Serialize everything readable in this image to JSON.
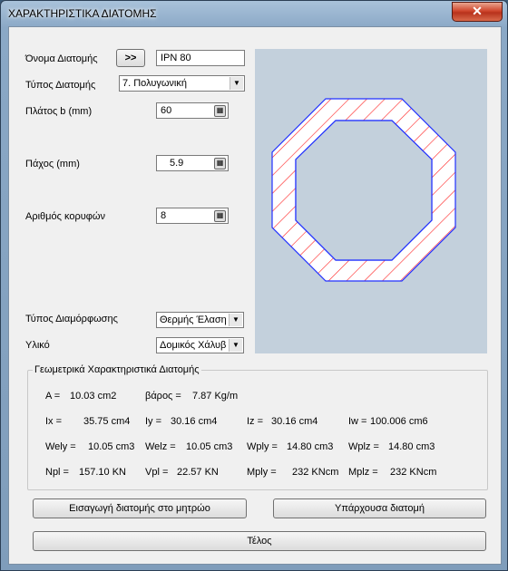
{
  "window": {
    "title": "ΧΑΡΑΚΤΗΡΙΣΤΙΚΑ ΔΙΑΤΟΜΗΣ",
    "close_symbol": "✕"
  },
  "form": {
    "name_label": "Όνομα Διατομής",
    "name_button": ">>",
    "name_value": "IPN 80",
    "type_label": "Τύπος Διατομής",
    "type_value": "7. Πολυγωνική",
    "width_label": "Πλάτος b (mm)",
    "width_value": "60",
    "thickness_label": "Πάχος (mm)",
    "thickness_value": "5.9",
    "vertices_label": "Αριθμός κορυφών",
    "vertices_value": "8",
    "forming_label": "Τύπος Διαμόρφωσης",
    "forming_value": "Θερμής Έλαση",
    "material_label": "Υλικό",
    "material_value": "Δομικός Χάλυβ"
  },
  "geometry": {
    "title": "Γεωμετρικά Χαρακτηριστικά Διατομής",
    "row1": [
      {
        "label": "A =",
        "value": "10.03 cm2"
      },
      {
        "label": "βάρος =",
        "value": "7.87 Kg/m"
      }
    ],
    "row2": [
      {
        "label": "Ix =",
        "value": "35.75 cm4"
      },
      {
        "label": "Iy =",
        "value": "30.16 cm4"
      },
      {
        "label": "Iz =",
        "value": "30.16 cm4"
      },
      {
        "label": "Iw =",
        "value": "100.006 cm6"
      }
    ],
    "row3": [
      {
        "label": "Wely =",
        "value": "10.05 cm3"
      },
      {
        "label": "Welz =",
        "value": "10.05 cm3"
      },
      {
        "label": "Wply =",
        "value": "14.80 cm3"
      },
      {
        "label": "Wplz =",
        "value": "14.80 cm3"
      }
    ],
    "row4": [
      {
        "label": "Npl =",
        "value": "157.10 KN"
      },
      {
        "label": "Vpl =",
        "value": "22.57 KN"
      },
      {
        "label": "Mply =",
        "value": "232 KNcm"
      },
      {
        "label": "Mplz =",
        "value": "232 KNcm"
      }
    ]
  },
  "buttons": {
    "insert": "Εισαγωγή διατομής στο μητρώο",
    "existing": "Υπάρχουσα διατομή",
    "end": "Τέλος"
  },
  "colors": {
    "outline": "#2030ff",
    "hatch": "#ff2020",
    "canvas_bg": "#c3d0dc"
  }
}
